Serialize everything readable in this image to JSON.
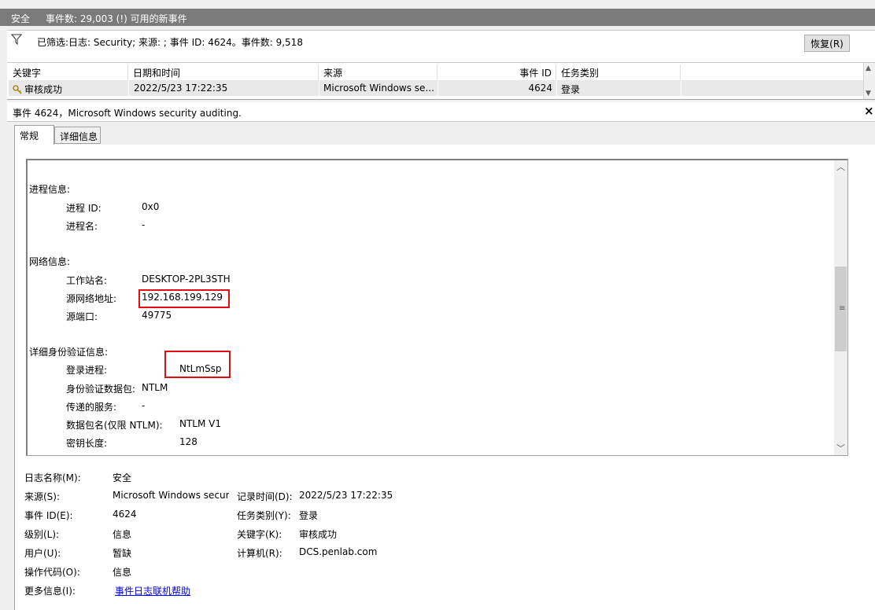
{
  "titlebar": {
    "log_name": "安全",
    "summary": "事件数: 29,003 (!) 可用的新事件"
  },
  "filter": {
    "text": "已筛选:日志: Security; 来源: ; 事件 ID: 4624。事件数: 9,518",
    "restore_button": "恢复(R)"
  },
  "grid": {
    "columns": [
      "关键字",
      "日期和时间",
      "来源",
      "事件 ID",
      "任务类别"
    ],
    "row": {
      "keyword": "审核成功",
      "datetime": "2022/5/23 17:22:35",
      "source": "Microsoft Windows se...",
      "event_id": "4624",
      "task": "登录"
    }
  },
  "detail": {
    "title": "事件 4624，Microsoft Windows security auditing.",
    "close": "×"
  },
  "tabs": [
    "常规",
    "详细信息"
  ],
  "description": {
    "process_header": "进程信息:",
    "process_id_label": "进程 ID:",
    "process_id": "0x0",
    "process_name_label": "进程名:",
    "process_name": "-",
    "network_header": "网络信息:",
    "workstation_label": "工作站名:",
    "workstation": "DESKTOP-2PL3STH",
    "src_addr_label": "源网络地址:",
    "src_addr": "192.168.199.129",
    "src_port_label": "源端口:",
    "src_port": "49775",
    "auth_header": "详细身份验证信息:",
    "logon_process_label": "登录进程:",
    "logon_process": "NtLmSsp",
    "auth_package_label": "身份验证数据包:",
    "auth_package": "NTLM",
    "transited_label": "传递的服务:",
    "transited": "-",
    "package_name_label": "数据包名(仅限 NTLM):",
    "package_name": "NTLM V1",
    "key_length_label": "密钥长度:",
    "key_length": "128"
  },
  "properties": {
    "log_name_label": "日志名称(M):",
    "log_name": "安全",
    "source_label": "来源(S):",
    "source": "Microsoft Windows secur",
    "logged_label": "记录时间(D):",
    "logged": "2022/5/23 17:22:35",
    "event_id_label": "事件 ID(E):",
    "event_id": "4624",
    "task_label": "任务类别(Y):",
    "task": "登录",
    "level_label": "级别(L):",
    "level": "信息",
    "keywords_label": "关键字(K):",
    "keywords": "审核成功",
    "user_label": "用户(U):",
    "user": "暂缺",
    "computer_label": "计算机(R):",
    "computer": "DCS.penlab.com",
    "opcode_label": "操作代码(O):",
    "opcode": "信息",
    "more_info_label": "更多信息(I):",
    "more_info_link": "事件日志联机帮助"
  },
  "colors": {
    "highlight_box": "#e01010",
    "titlebar_bg": "#7a7a7a",
    "link": "#0000ee"
  }
}
